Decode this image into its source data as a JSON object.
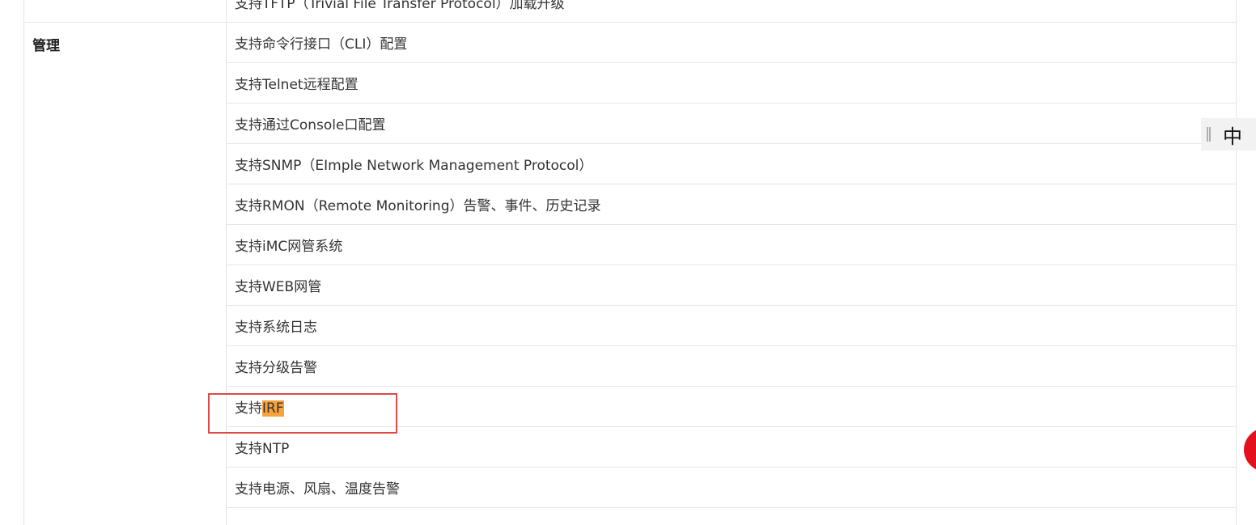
{
  "table": {
    "prev_row_text": "支持TFTP（Trivial File Transfer Protocol）加载升级",
    "category": "管理",
    "items": [
      "支持命令行接口（CLI）配置",
      "支持Telnet远程配置",
      "支持通过Console口配置",
      "支持SNMP（EImple Network Management Protocol）",
      "支持RMON（Remote Monitoring）告警、事件、历史记录",
      "支持iMC网管系统",
      "支持WEB网管",
      "支持系统日志",
      "支持分级告警",
      "支持",
      "支持NTP",
      "支持电源、风扇、温度告警"
    ],
    "highlight_term": "IRF"
  },
  "lang_switch": {
    "label": "中"
  },
  "colors": {
    "highlight": "#f7a23b",
    "box": "#e04848",
    "float_button": "#e5101d"
  }
}
